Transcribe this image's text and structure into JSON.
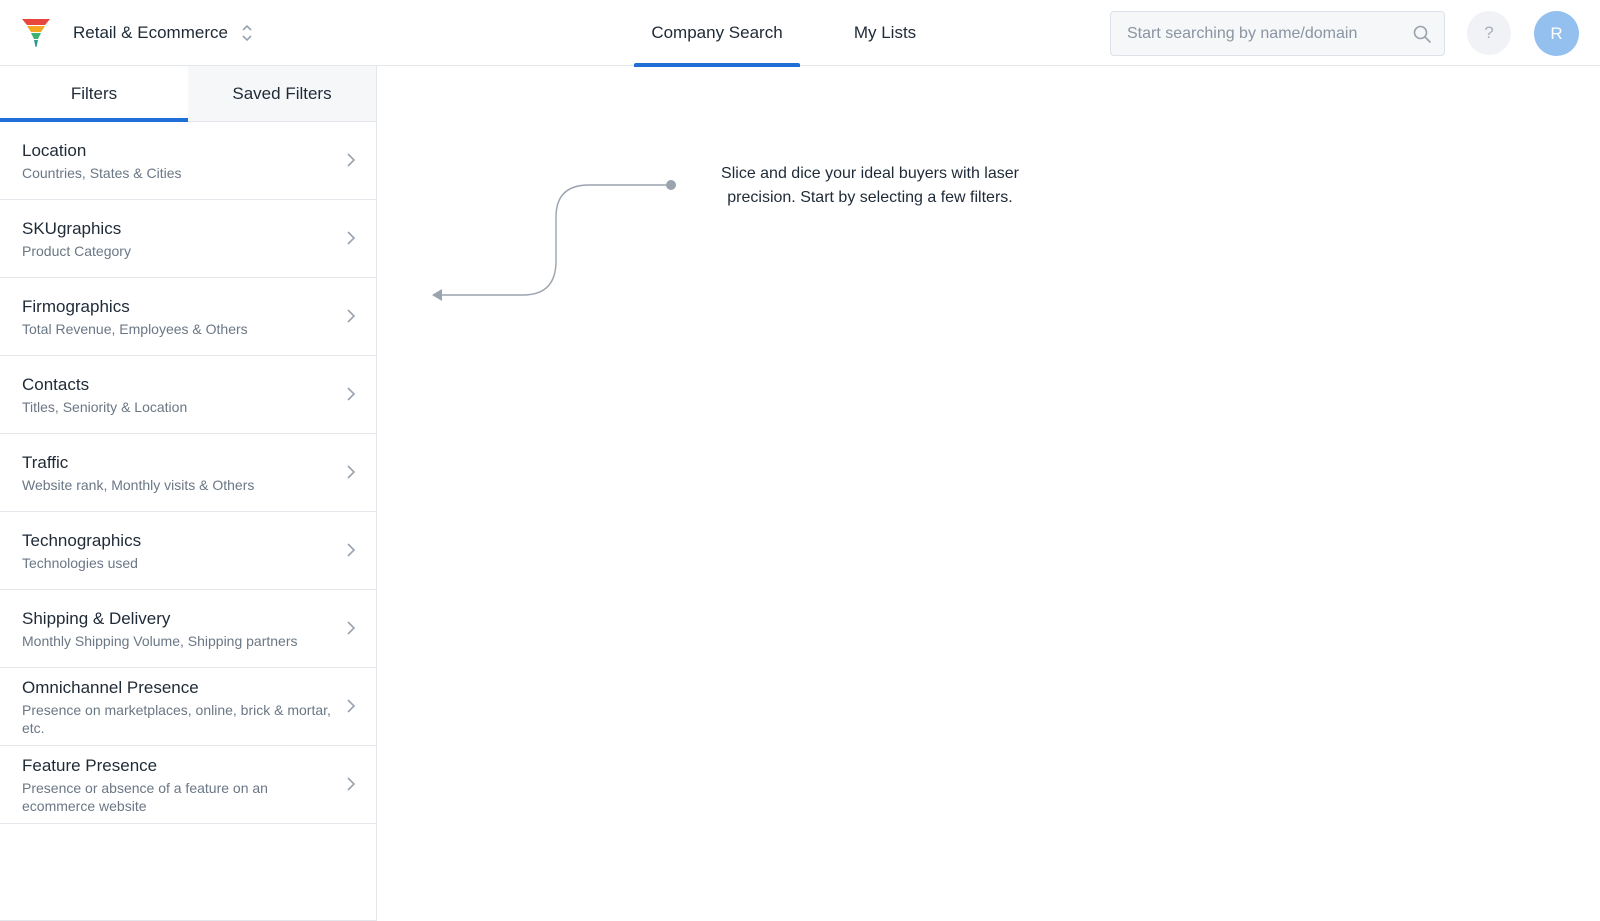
{
  "header": {
    "workspace_label": "Retail & Ecommerce",
    "nav_tabs": [
      {
        "label": "Company Search",
        "active": true
      },
      {
        "label": "My Lists",
        "active": false
      }
    ],
    "search": {
      "placeholder": "Start searching by name/domain"
    },
    "help_label": "?",
    "avatar_initial": "R"
  },
  "sidebar": {
    "tabs": [
      {
        "label": "Filters",
        "active": true
      },
      {
        "label": "Saved Filters",
        "active": false
      }
    ],
    "filters": [
      {
        "title": "Location",
        "subtitle": "Countries, States & Cities"
      },
      {
        "title": "SKUgraphics",
        "subtitle": "Product Category"
      },
      {
        "title": "Firmographics",
        "subtitle": "Total Revenue, Employees & Others"
      },
      {
        "title": "Contacts",
        "subtitle": "Titles, Seniority & Location"
      },
      {
        "title": "Traffic",
        "subtitle": "Website rank, Monthly visits & Others"
      },
      {
        "title": "Technographics",
        "subtitle": "Technologies used"
      },
      {
        "title": "Shipping & Delivery",
        "subtitle": "Monthly Shipping Volume, Shipping partners"
      },
      {
        "title": "Omnichannel Presence",
        "subtitle": "Presence on marketplaces, online, brick & mortar, etc."
      },
      {
        "title": "Feature Presence",
        "subtitle": "Presence or absence of a feature on an ecommerce website"
      }
    ]
  },
  "main": {
    "hint_text": "Slice and dice your ideal buyers with laser precision. Start by selecting a few filters."
  },
  "colors": {
    "accent": "#1f6fd6",
    "avatar_bg": "#93c0ef",
    "border": "#e3e6ea",
    "muted_text": "#6b7785"
  },
  "icons": {
    "logo": "funnel-logo-icon",
    "workspace_switch": "chevron-up-down-icon",
    "search": "search-icon",
    "filter_arrow": "chevron-right-icon"
  }
}
